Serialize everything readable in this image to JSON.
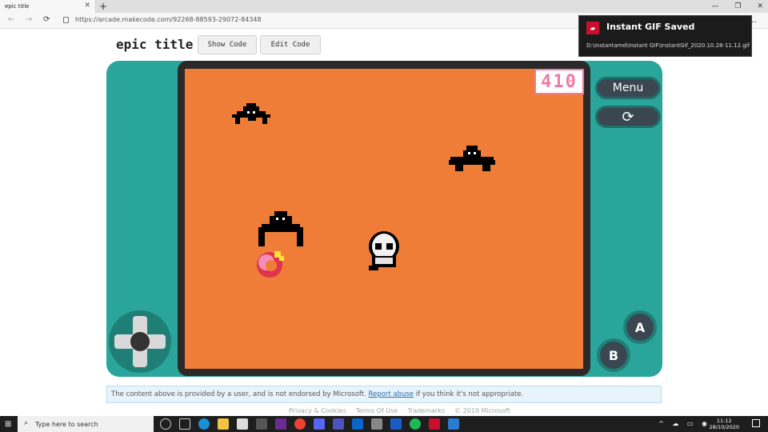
{
  "browser": {
    "tab_title": "epic title",
    "tab_close": "✕",
    "new_tab": "+",
    "window_controls": [
      "—",
      "❐",
      "✕"
    ],
    "back": "←",
    "forward": "→",
    "reload": "⟳",
    "url": "https://arcade.makecode.com/92268-88593-29072-84348",
    "more": "…"
  },
  "page": {
    "title": "epic title",
    "show_code_label": "Show Code",
    "edit_code_label": "Edit Code"
  },
  "game": {
    "score": "410",
    "menu_label": "Menu",
    "restart_icon": "⟳",
    "a_label": "A",
    "b_label": "B",
    "screen_color": "#ef7d37"
  },
  "notice": {
    "text_before": "The content above is provided by a user, and is not endorsed by Microsoft.",
    "link": "Report abuse",
    "text_after": "if you think it's not appropriate."
  },
  "footer_links": [
    "Privacy & Cookies",
    "Terms Of Use",
    "Trademarks",
    "© 2019 Microsoft"
  ],
  "toast": {
    "title": "Instant GIF Saved",
    "path": "D:\\instantamd\\Instant GIF\\InstantGif_2020.10.28-11.12.gif"
  },
  "taskbar": {
    "search_placeholder": "Type here to search",
    "time": "11:12",
    "date": "28/10/2020",
    "tray": "^ ☁ ▭ ◉"
  },
  "colors": {
    "sim_teal": "#2aa59b",
    "score_pink": "#f07aa5",
    "toast_red": "#c8102e"
  }
}
